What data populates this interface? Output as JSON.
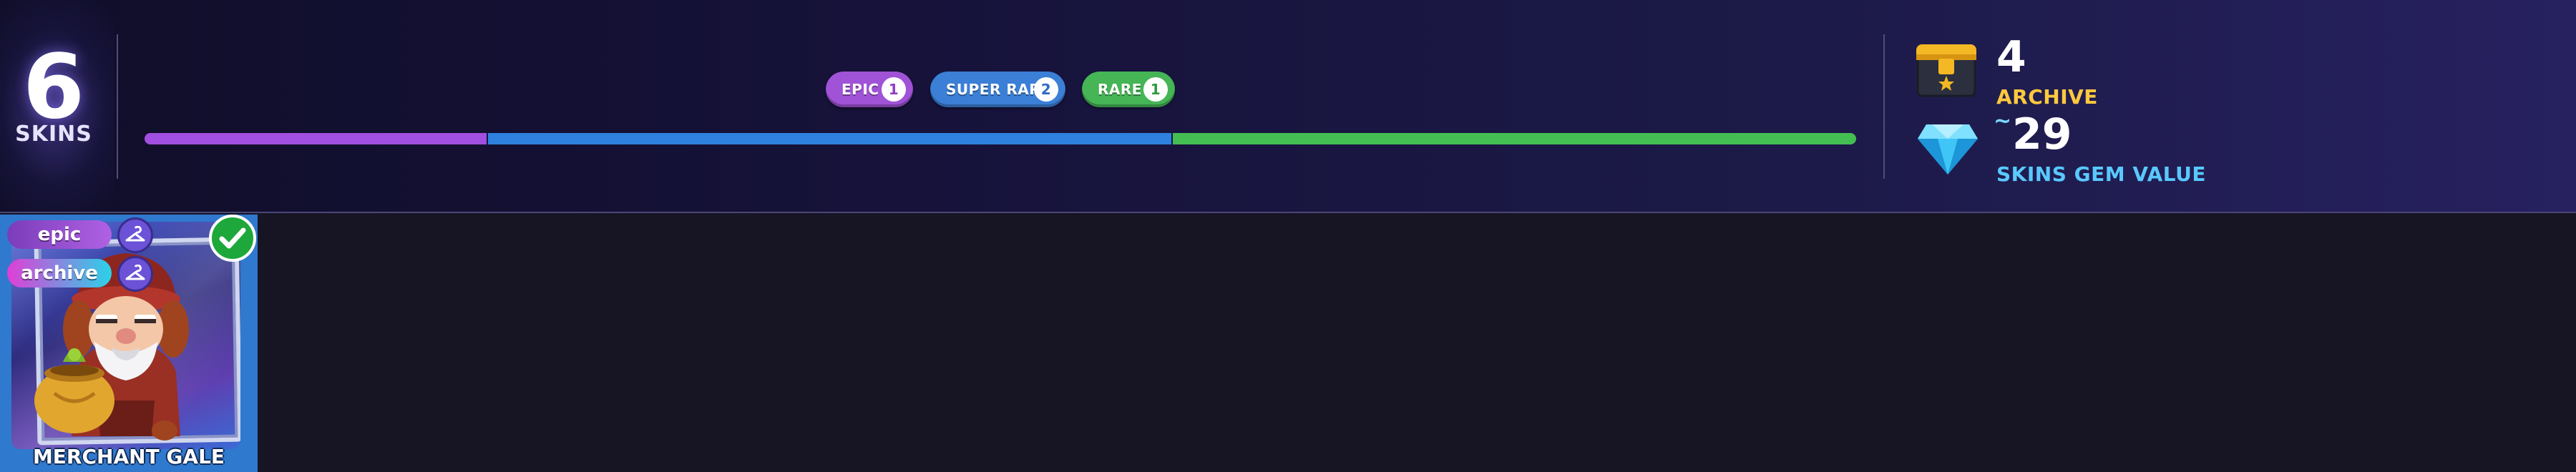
{
  "summary": {
    "count": "6",
    "label": "SKINS"
  },
  "rarities": [
    {
      "label": "EPIC",
      "count": "1",
      "color": "#a053d6"
    },
    {
      "label": "SUPER RARE",
      "count": "2",
      "color": "#3b7fd6"
    },
    {
      "label": "RARE",
      "count": "1",
      "color": "#45b556"
    }
  ],
  "distribution": [
    {
      "rarity": "EPIC",
      "fraction": 0.2
    },
    {
      "rarity": "SUPER RARE",
      "fraction": 0.4
    },
    {
      "rarity": "RARE",
      "fraction": 0.4
    }
  ],
  "stats": {
    "archive": {
      "value": "4",
      "label": "ARCHIVE",
      "icon": "chest-icon"
    },
    "gems": {
      "approx": "~",
      "value": "29",
      "label": "SKINS GEM VALUE",
      "icon": "gem-icon"
    }
  },
  "cards": [
    {
      "name": "MERCHANT GALE",
      "tags": [
        "epic",
        "archive"
      ],
      "selected": true,
      "background": "#2f79cf"
    }
  ],
  "colors": {
    "epic": "#a14fe0",
    "super_rare": "#2e81de",
    "rare": "#44be52",
    "archive": "#ffc93d",
    "gem": "#59c9ff"
  }
}
